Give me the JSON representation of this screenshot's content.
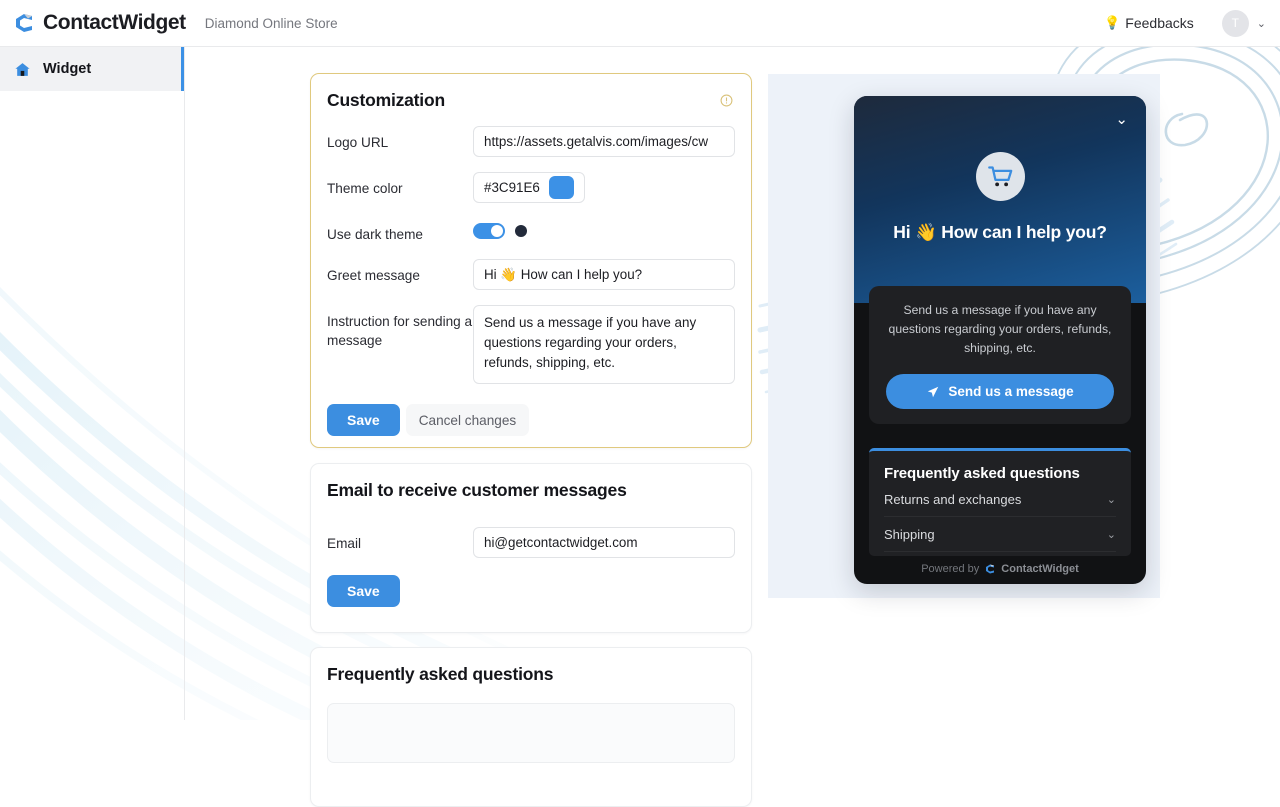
{
  "topbar": {
    "brand_name": "ContactWidget",
    "brand_logo_icon": "contactwidget-logo-icon",
    "store_name": "Diamond Online Store",
    "feedbacks_label": "Feedbacks",
    "bulb_icon": "💡",
    "avatar_initial": "T",
    "chevron_icon": "⌄"
  },
  "sidebar": {
    "items": [
      {
        "label": "Widget",
        "icon": "home-icon",
        "active": true
      }
    ]
  },
  "cards": {
    "customization": {
      "title": "Customization",
      "info_icon": "info-circle-icon",
      "fields": {
        "logo_url": {
          "label": "Logo URL",
          "value": "https://assets.getalvis.com/images/cw"
        },
        "theme_color": {
          "label": "Theme color",
          "value": "#3C91E6",
          "swatch": "#3C91E6"
        },
        "dark_theme": {
          "label": "Use dark theme",
          "enabled": true,
          "dot_color": "#232b3b"
        },
        "greet_message": {
          "label": "Greet message",
          "value": "Hi 👋 How can I help you?"
        },
        "instruction": {
          "label": "Instruction for sending a message",
          "value": "Send us a message if you have any questions regarding your orders, refunds, shipping, etc."
        }
      },
      "save_label": "Save",
      "cancel_label": "Cancel changes"
    },
    "email": {
      "title": "Email to receive customer messages",
      "fields": {
        "email": {
          "label": "Email",
          "value": "hi@getcontactwidget.com"
        }
      },
      "save_label": "Save"
    },
    "faq": {
      "title": "Frequently asked questions"
    }
  },
  "preview": {
    "widget": {
      "collapse_icon": "chevron-down-icon",
      "avatar_icon": "shopping-cart-icon",
      "greet_message": "Hi 👋 How can I help you?",
      "instruction": "Send us a message if you have any questions regarding your orders, refunds, shipping, etc.",
      "send_button_label": "Send us a message",
      "send_icon": "paper-plane-icon",
      "faq_title": "Frequently asked questions",
      "faq_items": [
        {
          "label": "Returns and exchanges",
          "chevron": "⌄"
        },
        {
          "label": "Shipping",
          "chevron": "⌄"
        }
      ],
      "powered_by_text": "Powered by",
      "powered_by_brand": "ContactWidget",
      "powered_by_icon": "contactwidget-logo-icon"
    }
  },
  "colors": {
    "accent": "#3C91E6",
    "highlight_border": "#E0C97E",
    "preview_bg": "#EDF2F9",
    "widget_bg": "#111214"
  }
}
